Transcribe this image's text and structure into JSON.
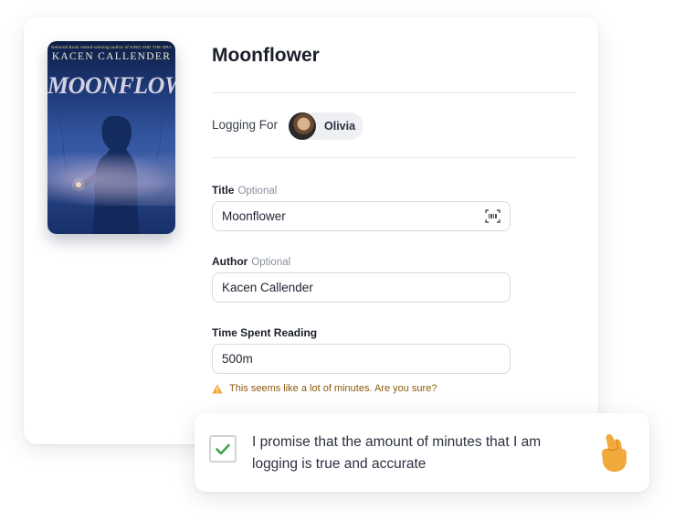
{
  "book": {
    "title": "Moonflower",
    "cover": {
      "tagline": "National Book Award-winning author of KING AND THE DRAGONFLIES",
      "author": "KACEN CALLENDER",
      "title": "MOONFLOWER"
    }
  },
  "logging": {
    "label": "Logging For",
    "user_name": "Olivia"
  },
  "form": {
    "title": {
      "label": "Title",
      "optional": "Optional",
      "value": "Moonflower"
    },
    "author": {
      "label": "Author",
      "optional": "Optional",
      "value": "Kacen Callender"
    },
    "time": {
      "label": "Time Spent Reading",
      "value": "500m"
    },
    "warning": "This seems like a lot of minutes. Are you sure?"
  },
  "promise": {
    "text": "I promise that the amount of minutes that I am logging is true and accurate",
    "checked": true
  },
  "colors": {
    "check": "#3fa24a",
    "warning_icon": "#f0a830",
    "hand": "#f2a93b"
  }
}
